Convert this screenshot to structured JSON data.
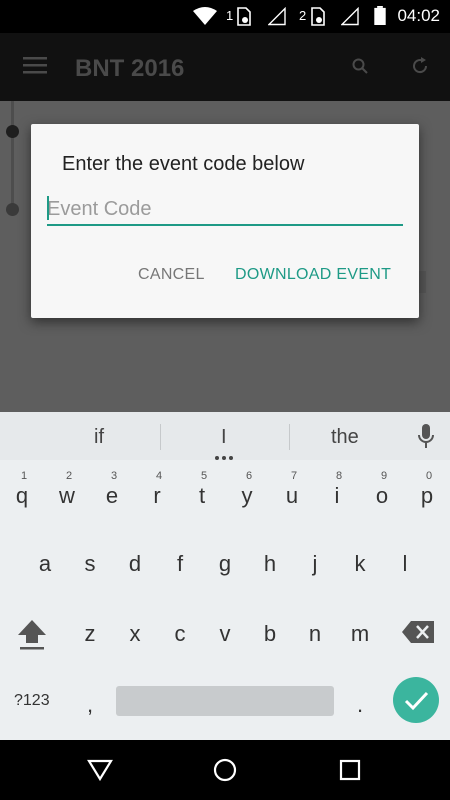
{
  "status": {
    "time": "04:02",
    "sim1": "1",
    "sim2": "2"
  },
  "appbar": {
    "title": "BNT 2016"
  },
  "dialog": {
    "title": "Enter the event code below",
    "input_placeholder": "Event Code",
    "input_value": "",
    "cancel_label": "CANCEL",
    "download_label": "DOWNLOAD EVENT"
  },
  "keyboard": {
    "suggestions": [
      "if",
      "I",
      "the"
    ],
    "row1": [
      "q",
      "w",
      "e",
      "r",
      "t",
      "y",
      "u",
      "i",
      "o",
      "p"
    ],
    "row1_hints": [
      "1",
      "2",
      "3",
      "4",
      "5",
      "6",
      "7",
      "8",
      "9",
      "0"
    ],
    "row2": [
      "a",
      "s",
      "d",
      "f",
      "g",
      "h",
      "j",
      "k",
      "l"
    ],
    "row3": [
      "z",
      "x",
      "c",
      "v",
      "b",
      "n",
      "m"
    ],
    "symbols_label": "?123",
    "comma": ",",
    "period": "."
  },
  "colors": {
    "accent": "#1e9a86",
    "enter": "#3bb59e"
  }
}
